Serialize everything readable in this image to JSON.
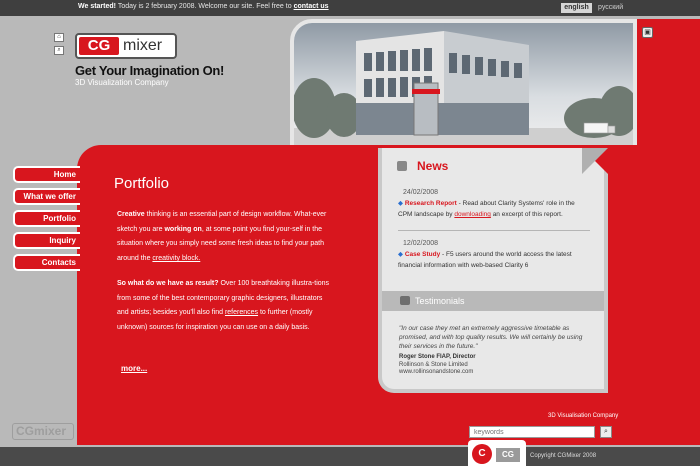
{
  "topbar": {
    "started": "We started!",
    "message": " Today is 2 february 2008. Welcome our site. Feel free to ",
    "contact_link": "contact us",
    "lang_en": "english",
    "lang_ru": "русский"
  },
  "header": {
    "logo_cg": "CG",
    "logo_mixer": "mixer",
    "tagline": "Get Your Imagination On!",
    "subtagline": "3D Visualization Company"
  },
  "nav": {
    "items": [
      {
        "label": "Home"
      },
      {
        "label": "What we offer"
      },
      {
        "label": "Portfolio"
      },
      {
        "label": "Inquiry"
      },
      {
        "label": "Contacts"
      }
    ]
  },
  "portfolio": {
    "title": "Portfolio",
    "p1_b1": "Creative",
    "p1_t1": " thinking is an essential part of design workflow. What-ever sketch you are ",
    "p1_b2": "working on",
    "p1_t2": ", at some point you find your-self in the situation where you simply need some fresh ideas to find your path around the ",
    "p1_link": "creativity block.",
    "p2_b1": "So what do we have as result?",
    "p2_t1": " Over 100 breathtaking illustra-tions from some of the best contemporary graphic designers, illustrators and artists; besides you'll also find ",
    "p2_link": "references",
    "p2_t2": " to further (mostly unknown) sources for inspiration you can use on a daily basis.",
    "more": "more..."
  },
  "news": {
    "title": "News",
    "items": [
      {
        "date": "24/02/2008",
        "headline": "Research Report",
        "text1": " - Read about Clarity Systems' role in the CPM landscape by ",
        "link": "downloading",
        "text2": " an excerpt of this report."
      },
      {
        "date": "12/02/2008",
        "headline": "Case Study",
        "text1": " - F5 users around the world access the latest financial information with web-based Clarity 6",
        "link": "",
        "text2": ""
      }
    ]
  },
  "testimonials": {
    "title": "Testimonials",
    "quote": "\"In our case they met an extremely aggressive timetable as promised, and with top quality results. We will certainly be using their services in the future.\"",
    "author_name": "Roger Stone FIAP, Director",
    "author_company": "Rollinson & Stone Limited",
    "author_site": "www.rollinsonandstone.com"
  },
  "footer": {
    "company": "3D Visualisation Company",
    "search_placeholder": "keywords",
    "copyright": "Copyright CGMixer 2008",
    "watermark": "CGmixer"
  },
  "colors": {
    "brand_red": "#d8161e",
    "grey_bg": "#b9b9b9",
    "dark_bar": "#3f3f3f"
  },
  "icons": {
    "home": "home-icon",
    "search": "search-icon",
    "corner": "window-icon",
    "news": "news-icon",
    "testimonials": "speech-bubble-icon"
  }
}
